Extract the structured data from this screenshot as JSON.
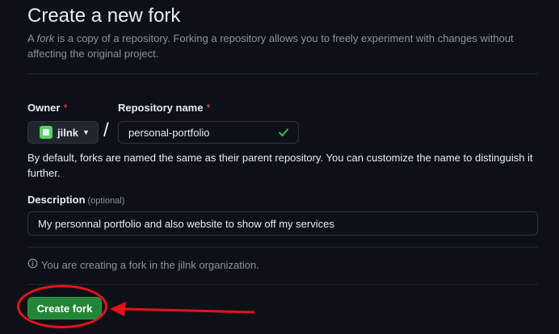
{
  "header": {
    "title": "Create a new fork",
    "subtitle_prefix": "A ",
    "subtitle_em": "fork",
    "subtitle_rest": " is a copy of a repository. Forking a repository allows you to freely experiment with changes without affecting the original project."
  },
  "owner": {
    "label": "Owner",
    "required_mark": "*",
    "selected": "jilnk",
    "icon": "caret-down-icon"
  },
  "repository": {
    "label": "Repository name",
    "required_mark": "*",
    "separator": "/",
    "value": "personal-portfolio",
    "valid_icon": "check-icon",
    "hint": "By default, forks are named the same as their parent repository. You can customize the name to distinguish it further."
  },
  "description": {
    "label": "Description",
    "optional": "(optional)",
    "value": "My personnal portfolio and also website to show off my services"
  },
  "info": {
    "icon": "info-icon",
    "text": "You are creating a fork in the jilnk organization."
  },
  "actions": {
    "create_label": "Create fork"
  },
  "colors": {
    "background": "#0d1117",
    "primary_button": "#238636",
    "required": "#f85149",
    "valid_check": "#3fb950",
    "annotation": "#e5121b"
  }
}
